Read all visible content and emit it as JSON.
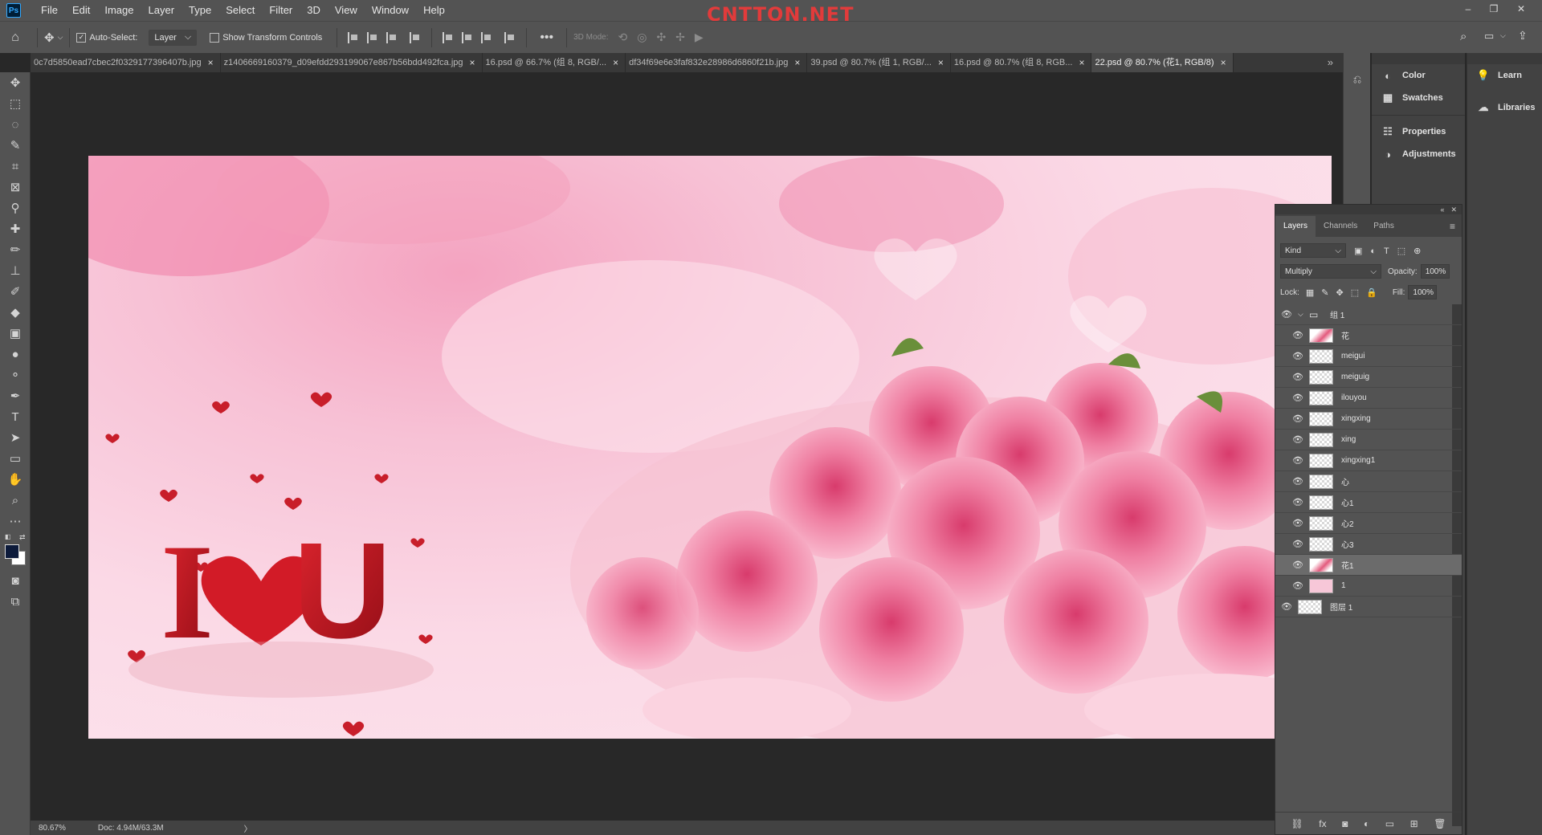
{
  "app": {
    "logo": "Ps",
    "menu": [
      "File",
      "Edit",
      "Image",
      "Layer",
      "Type",
      "Select",
      "Filter",
      "3D",
      "View",
      "Window",
      "Help"
    ],
    "watermark": "CNTTQN.NET",
    "window_controls": {
      "minimize": "–",
      "restore": "❐",
      "close": "✕"
    }
  },
  "options": {
    "auto_select_label": "Auto-Select:",
    "auto_select_target": "Layer",
    "show_transform_label": "Show Transform Controls",
    "mode_3d_label": "3D Mode:"
  },
  "tabs": [
    {
      "label": "0c7d5850ead7cbec2f0329177396407b.jpg",
      "active": false
    },
    {
      "label": "z1406669160379_d09efdd293199067e867b56bdd492fca.jpg",
      "active": false
    },
    {
      "label": "16.psd @ 66.7% (组 8, RGB/...",
      "active": false
    },
    {
      "label": "df34f69e6e3faf832e28986d6860f21b.jpg",
      "active": false
    },
    {
      "label": "39.psd @ 80.7% (组 1, RGB/...",
      "active": false
    },
    {
      "label": "16.psd @ 80.7% (组 8, RGB...",
      "active": false
    },
    {
      "label": "22.psd @ 80.7% (花1, RGB/8)",
      "active": true
    }
  ],
  "tab_close": "×",
  "tab_overflow": "»",
  "artwork": {
    "letter_i": "I",
    "letter_u": "U"
  },
  "status": {
    "zoom": "80.67%",
    "doc": "Doc: 4.94M/63.3M",
    "arrow": "〉"
  },
  "panels_col1": [
    {
      "icon": "color-icon",
      "label": "Color"
    },
    {
      "icon": "swatches-icon",
      "label": "Swatches"
    },
    {
      "icon": "properties-icon",
      "label": "Properties"
    },
    {
      "icon": "adjustments-icon",
      "label": "Adjustments"
    }
  ],
  "panels_col2": [
    {
      "icon": "learn-icon",
      "label": "Learn"
    },
    {
      "icon": "libraries-icon",
      "label": "Libraries"
    }
  ],
  "layers_panel": {
    "tabs": [
      "Layers",
      "Channels",
      "Paths"
    ],
    "filter_kind": "Kind",
    "blend_mode": "Multiply",
    "opacity_label": "Opacity:",
    "opacity_value": "100%",
    "lock_label": "Lock:",
    "fill_label": "Fill:",
    "fill_value": "100%",
    "group_name": "组 1",
    "layers": [
      {
        "name": "花",
        "thumb": "rose",
        "selected": false
      },
      {
        "name": "meigui",
        "thumb": "checker",
        "selected": false
      },
      {
        "name": "meiguig",
        "thumb": "checker",
        "selected": false
      },
      {
        "name": "ilouyou",
        "thumb": "checker",
        "selected": false
      },
      {
        "name": "xingxing",
        "thumb": "checker",
        "selected": false
      },
      {
        "name": "xing",
        "thumb": "checker",
        "selected": false
      },
      {
        "name": "xingxing1",
        "thumb": "checker",
        "selected": false
      },
      {
        "name": "心",
        "thumb": "checker",
        "selected": false
      },
      {
        "name": "心1",
        "thumb": "checker",
        "selected": false
      },
      {
        "name": "心2",
        "thumb": "checker",
        "selected": false
      },
      {
        "name": "心3",
        "thumb": "checker",
        "selected": false
      },
      {
        "name": "花1",
        "thumb": "rose",
        "selected": true
      },
      {
        "name": "1",
        "thumb": "pink",
        "selected": false
      }
    ],
    "background_layer": "图层 1"
  },
  "colors": {
    "ui_dark": "#282828",
    "ui_panel": "#535353",
    "accent_ps": "#31a8ff",
    "watermark_red": "#e23b3b",
    "rose_pink": "#e35a7d",
    "heart_red": "#c81e2a"
  }
}
